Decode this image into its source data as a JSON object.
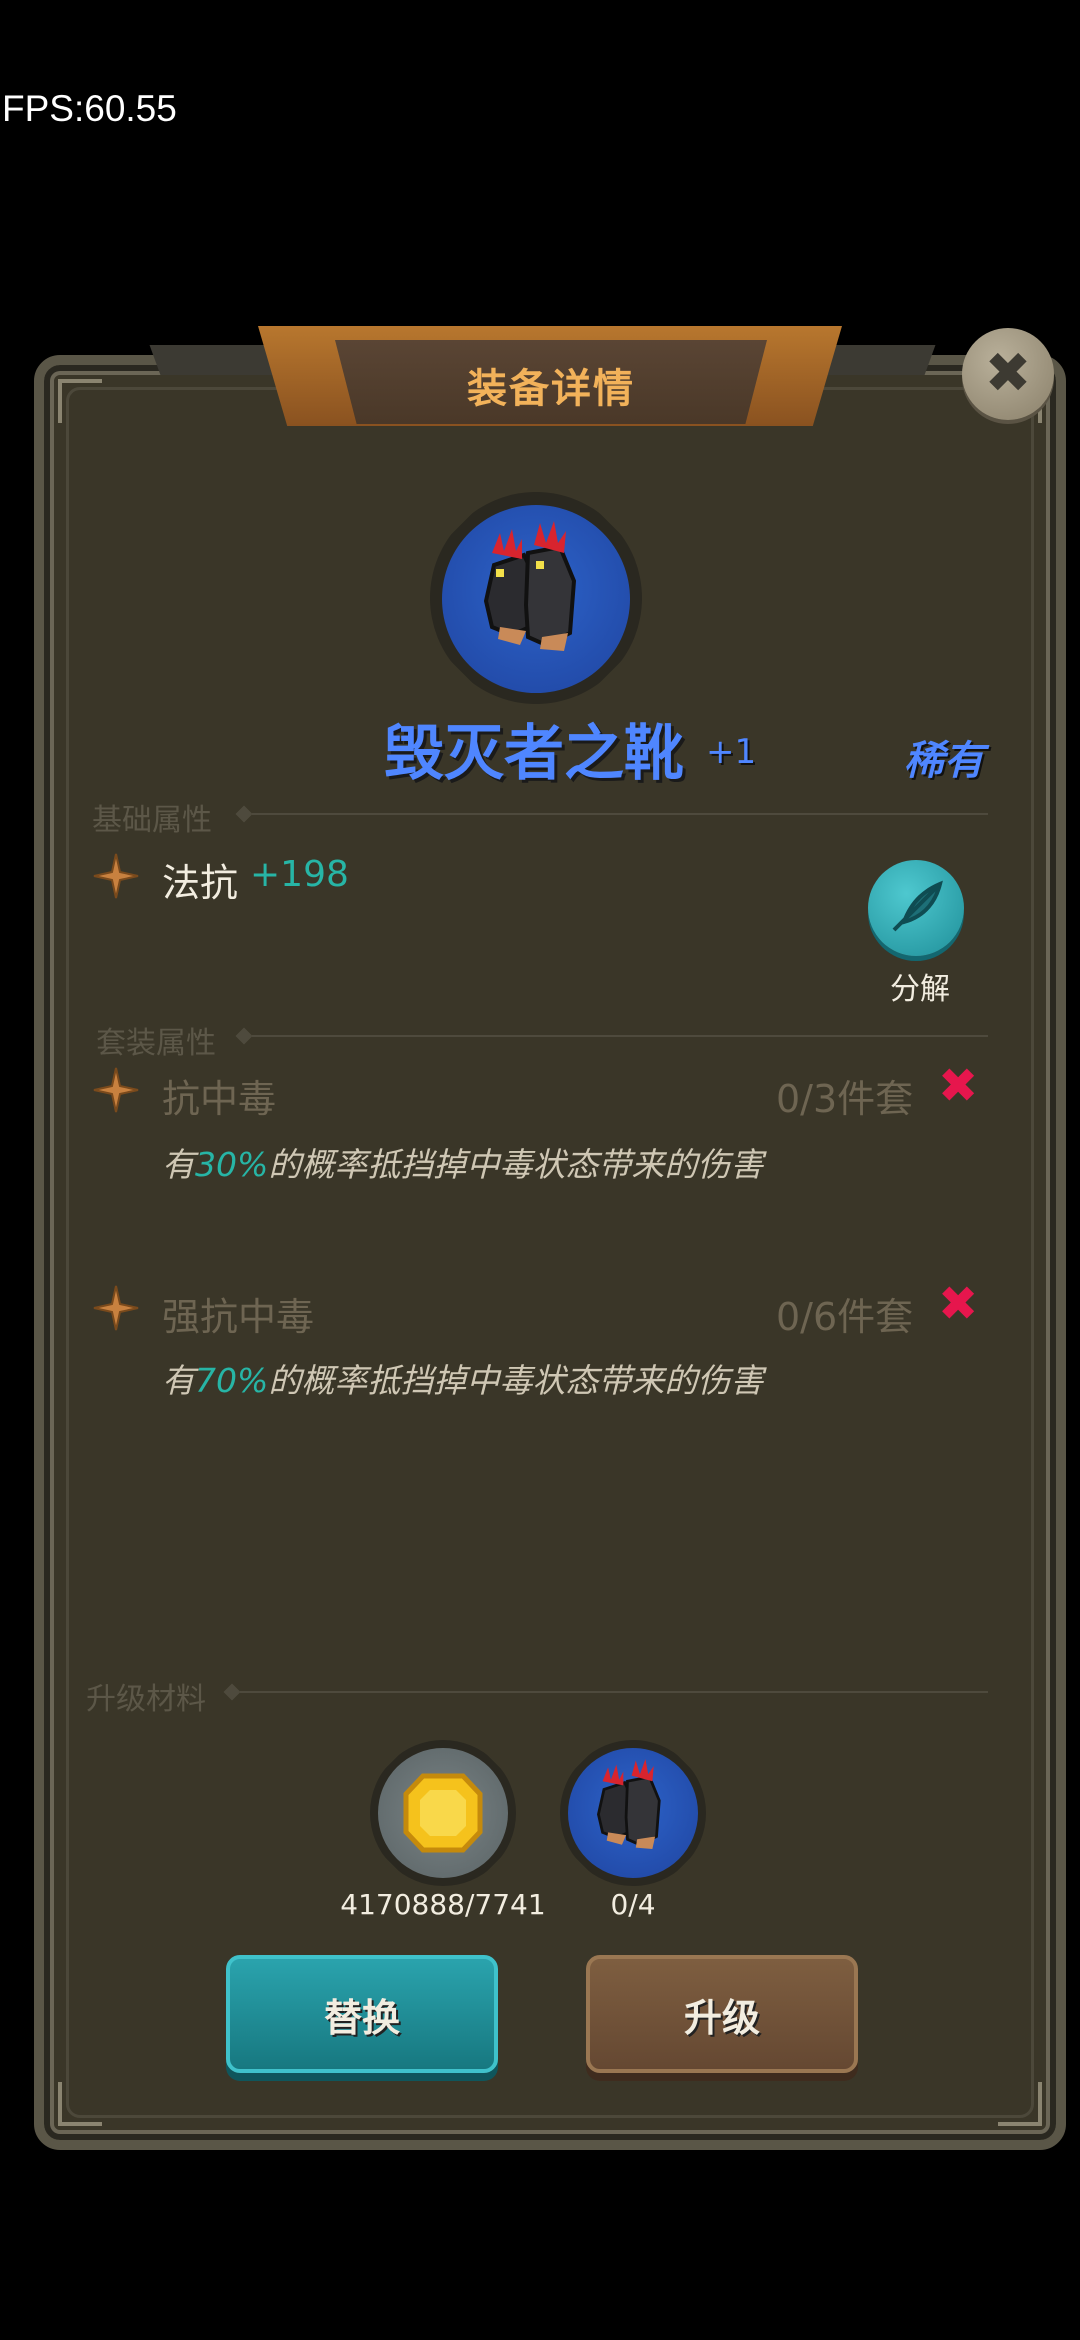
{
  "fps": "FPS:60.55",
  "dialog": {
    "title": "装备详情",
    "close_icon": "close-icon"
  },
  "item": {
    "name": "毁灭者之靴",
    "level": "+1",
    "rarity": "稀有",
    "icon": "boots-icon",
    "icon_bg_color": "#2448a8",
    "name_color": "#4f86ff"
  },
  "base_attributes": {
    "label": "基础属性",
    "stats": [
      {
        "name": "法抗",
        "value": "+198"
      }
    ]
  },
  "decompose": {
    "label": "分解",
    "icon": "feather-icon"
  },
  "set_attributes": {
    "label": "套装属性",
    "sets": [
      {
        "name": "抗中毒",
        "count": "0/3件套",
        "status_icon": "x-icon",
        "desc_prefix": "有",
        "desc_pct": "30%",
        "desc_suffix": "的概率抵挡掉中毒状态带来的伤害"
      },
      {
        "name": "强抗中毒",
        "count": "0/6件套",
        "status_icon": "x-icon",
        "desc_prefix": "有",
        "desc_pct": "70%",
        "desc_suffix": "的概率抵挡掉中毒状态带来的伤害"
      }
    ]
  },
  "upgrade_materials": {
    "label": "升级材料",
    "items": [
      {
        "icon": "gold-coin-icon",
        "count": "4170888/7741"
      },
      {
        "icon": "boots-icon",
        "count": "0/4"
      }
    ]
  },
  "buttons": {
    "replace": "替换",
    "upgrade": "升级"
  },
  "colors": {
    "accent_teal": "#27b5a6",
    "rarity_blue": "#4f86ff",
    "inactive_red": "#e6164d",
    "title_orange": "#f2b25a"
  }
}
